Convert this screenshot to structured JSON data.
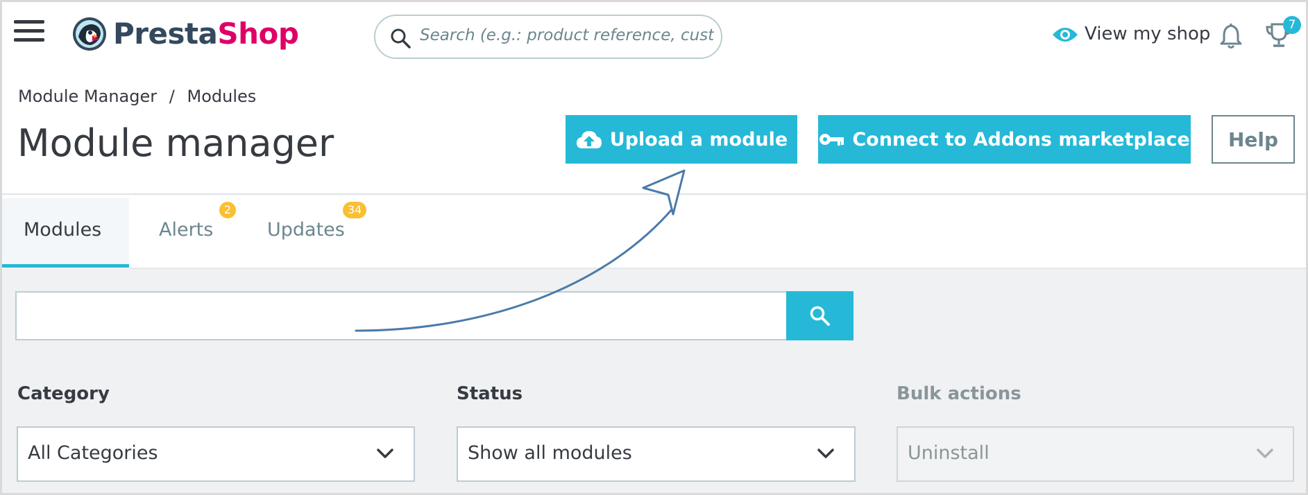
{
  "header": {
    "logo": {
      "presta": "Presta",
      "shop": "Shop"
    },
    "search": {
      "placeholder": "Search (e.g.: product reference, custome"
    },
    "view_shop_label": "View my shop",
    "notifications_count": "7"
  },
  "breadcrumb": {
    "parent": "Module Manager",
    "separator": "/",
    "current": "Modules"
  },
  "page": {
    "title": "Module manager"
  },
  "toolbar": {
    "upload_label": "Upload a module",
    "connect_label": "Connect to Addons marketplace",
    "help_label": "Help"
  },
  "tabs": [
    {
      "label": "Modules",
      "active": true,
      "badge": ""
    },
    {
      "label": "Alerts",
      "active": false,
      "badge": "2"
    },
    {
      "label": "Updates",
      "active": false,
      "badge": "34"
    }
  ],
  "filters": {
    "search_value": "",
    "category": {
      "label": "Category",
      "value": "All Categories"
    },
    "status": {
      "label": "Status",
      "value": "Show all modules"
    },
    "bulk": {
      "label": "Bulk actions",
      "value": "Uninstall"
    }
  },
  "colors": {
    "primary": "#25b9d7",
    "logo_dark": "#34495e",
    "logo_pink": "#df0067",
    "badge_orange": "#fab000",
    "annotation_arrow": "#4a7ba8"
  },
  "icons": {
    "menu": "hamburger-icon",
    "search": "search-icon",
    "eye": "eye-icon",
    "bell": "bell-icon",
    "trophy": "trophy-icon",
    "upload": "cloud-upload-icon",
    "key": "key-icon",
    "chevron": "chevron-down-icon"
  }
}
